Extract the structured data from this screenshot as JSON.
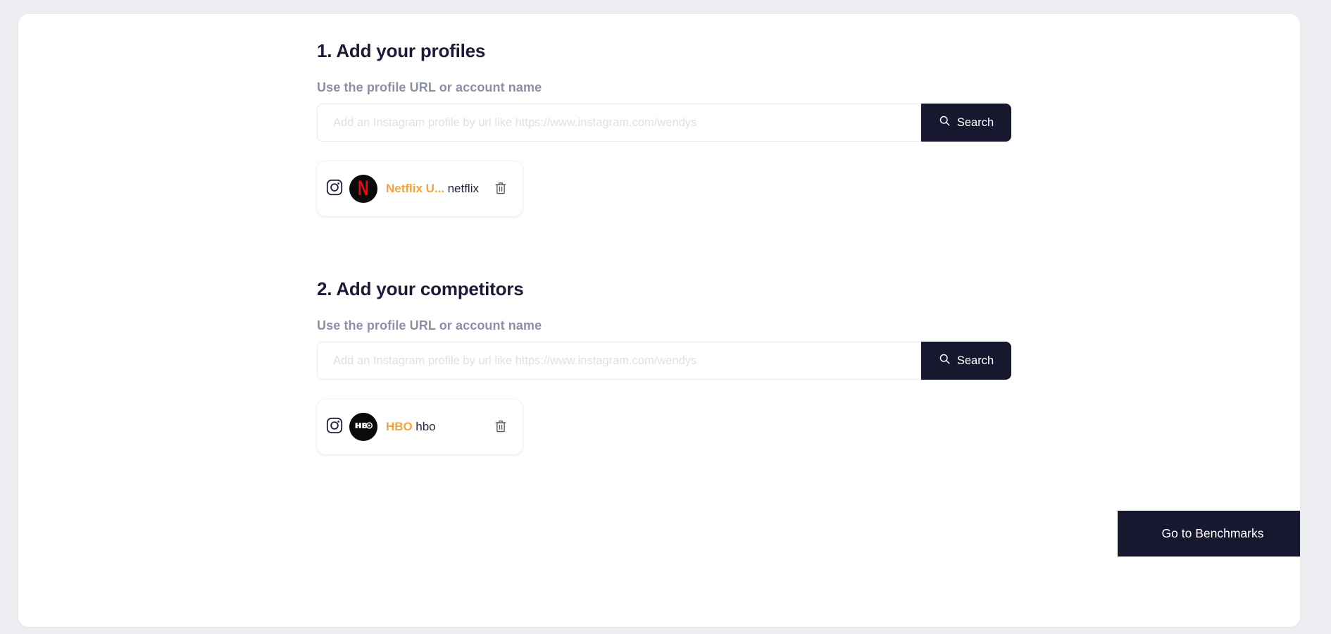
{
  "sections": [
    {
      "title": "1. Add your profiles",
      "label": "Use the profile URL or account name",
      "placeholder": "Add an Instagram profile by url like https://www.instagram.com/wendys",
      "value": "",
      "search_label": "Search",
      "profiles": [
        {
          "name": "Netflix U...",
          "handle": "netflix",
          "network": "instagram",
          "avatar_letter": "N",
          "avatar_bg": "#0a0a0a",
          "avatar_fg": "#e50914"
        }
      ]
    },
    {
      "title": "2. Add your competitors",
      "label": "Use the profile URL or account name",
      "placeholder": "Add an Instagram profile by url like https://www.instagram.com/wendys",
      "value": "",
      "search_label": "Search",
      "profiles": [
        {
          "name": "HBO",
          "handle": "hbo",
          "network": "instagram",
          "avatar_letter": "HBO",
          "avatar_bg": "#0a0a0a",
          "avatar_fg": "#ffffff"
        }
      ]
    }
  ],
  "footer": {
    "cta_label": "Go to Benchmarks"
  },
  "icons": {
    "instagram": "instagram-icon",
    "search": "search-icon",
    "delete": "trash-icon"
  },
  "colors": {
    "page_background": "#eceef2",
    "card_background": "#ffffff",
    "accent_dark": "#171730",
    "profile_name": "#f5a33c",
    "label_muted": "#8c8fa8",
    "placeholder": "#dfdfe6"
  }
}
